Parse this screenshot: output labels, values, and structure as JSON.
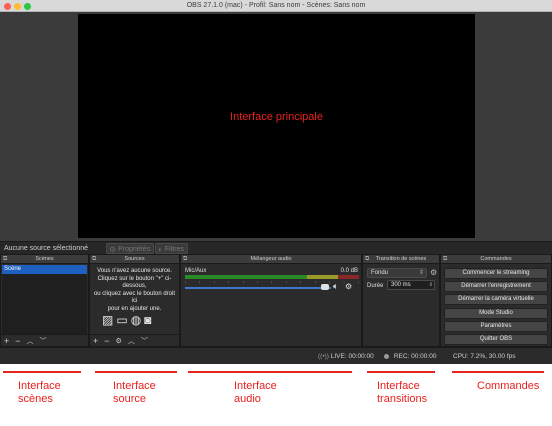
{
  "window": {
    "title": "OBS 27.1.0 (mac) - Profil: Sans nom - Scènes: Sans nom"
  },
  "preview": {
    "label": "Interface principale"
  },
  "source_bar": {
    "no_source": "Aucune source sélectionné",
    "properties": "Propriétés",
    "filters": "Filtres"
  },
  "docks": {
    "scenes": {
      "title": "Scènes",
      "items": [
        "Scène"
      ]
    },
    "sources": {
      "title": "Sources",
      "empty_hint": "Vous n'avez aucune source.\nCliquez sur le bouton \"+\" ci-\ndessous,\nou cliquez avec le bouton droit ici\npour en ajouter une."
    },
    "mixer": {
      "title": "Mélangeur audio",
      "channel": "Mic/Aux",
      "db": "0.0 dB",
      "level_fraction": 0.96
    },
    "transitions": {
      "title": "Transition de scènes",
      "selected": "Fondu",
      "duration_label": "Durée",
      "duration_value": "300 ms"
    },
    "controls": {
      "title": "Commandes",
      "buttons": [
        "Commencer le streaming",
        "Démarrer l'enregistrement",
        "Démarrer la caméra virtuelle",
        "Mode Studio",
        "Paramètres",
        "Quitter OBS"
      ]
    }
  },
  "status": {
    "live": "LIVE: 00:00:00",
    "rec": "REC: 00:00:00",
    "cpu": "CPU: 7.2%, 30.00 fps"
  },
  "annotations": [
    {
      "text": "Interface\nscènes"
    },
    {
      "text": "Interface\nsource"
    },
    {
      "text": "Interface\naudio"
    },
    {
      "text": "Interface\ntransitions"
    },
    {
      "text": "Commandes"
    }
  ],
  "colors": {
    "annotation": "#e8221f",
    "selection": "#1e60c0",
    "accent": "#3f77d0"
  },
  "icons": {
    "source_types": [
      "image-icon",
      "display-icon",
      "globe-icon",
      "camera-icon"
    ]
  }
}
